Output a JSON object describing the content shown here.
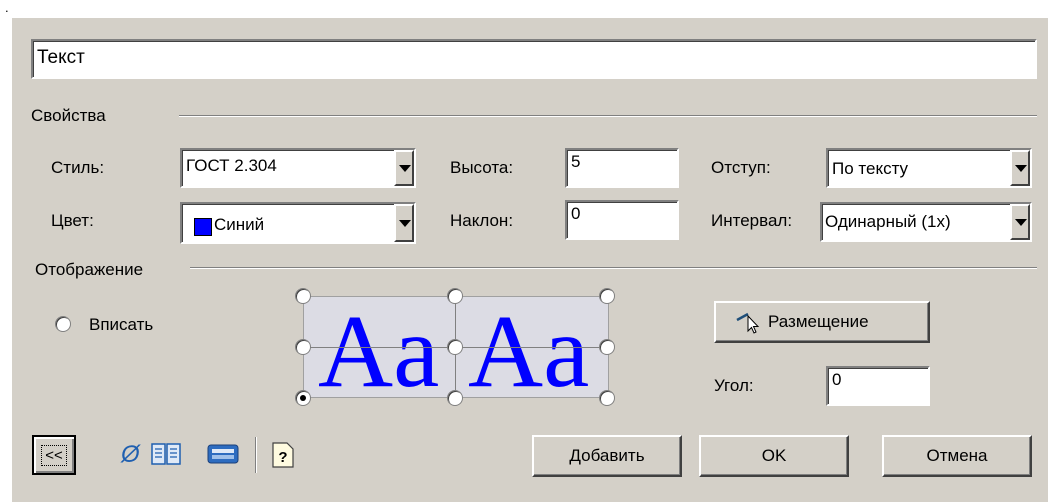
{
  "corner_mark": ".",
  "title_field": {
    "value": "Текст"
  },
  "properties": {
    "group_label": "Свойства",
    "style": {
      "label": "Стиль:",
      "value": "ГОСТ 2.304"
    },
    "color": {
      "label": "Цвет:",
      "value": "Синий",
      "swatch": "#0000ff"
    },
    "height": {
      "label": "Высота:",
      "value": "5"
    },
    "slant": {
      "label": "Наклон:",
      "value": "0"
    },
    "indent": {
      "label": "Отступ:",
      "value": "По тексту"
    },
    "interval": {
      "label": "Интервал:",
      "value": "Одинарный (1x)"
    }
  },
  "display": {
    "group_label": "Отображение",
    "fit_radio_label": "Вписать",
    "preview_text": [
      "Aa",
      "Aa"
    ],
    "preview_color": "#0000ff",
    "placement_button": "Размещение",
    "angle": {
      "label": "Угол:",
      "value": "0"
    }
  },
  "footer": {
    "collapse_button": "<<",
    "add_button": "Добавить",
    "ok_button": "OK",
    "cancel_button": "Отмена",
    "diameter_symbol": "Ø"
  }
}
